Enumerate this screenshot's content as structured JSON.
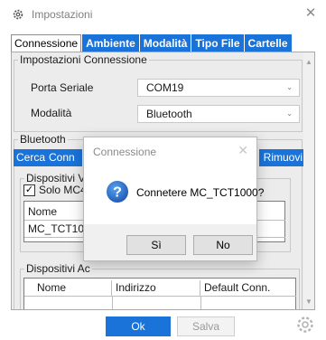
{
  "window": {
    "title": "Impostazioni",
    "close_glyph": "✕"
  },
  "tabs": [
    {
      "label": "Connessione",
      "active": true
    },
    {
      "label": "Ambiente",
      "active": false
    },
    {
      "label": "Modalità",
      "active": false
    },
    {
      "label": "Tipo File",
      "active": false
    },
    {
      "label": "Cartelle",
      "active": false
    }
  ],
  "connection_settings": {
    "legend": "Impostazioni Connessione",
    "serial_port_label": "Porta Seriale",
    "serial_port_value": "COM19",
    "mode_label": "Modalità",
    "mode_value": "Bluetooth"
  },
  "bluetooth": {
    "legend": "Bluetooth",
    "search_button": "Cerca",
    "connect_button_partial": "Conn",
    "remove_button_partial": "Rimuovi",
    "visible_devices_legend_partial": "Dispositivi Vi",
    "only_checkbox_label_partial": "Solo MC4",
    "only_checkbox_checked": true,
    "visible_grid_header_name": "Nome",
    "visible_grid_row_name_partial": "MC_TCT100",
    "associated_devices_legend_partial": "Dispositivi Ac",
    "associated_grid_headers": [
      "Nome",
      "Indirizzo",
      "Default Conn."
    ]
  },
  "footer": {
    "ok_label": "Ok",
    "save_label": "Salva"
  },
  "dialog": {
    "title": "Connessione",
    "message": "Connetere MC_TCT1000?",
    "yes_label": "Sì",
    "no_label": "No",
    "icon": "question-icon"
  },
  "colors": {
    "accent": "#1a73d9"
  }
}
